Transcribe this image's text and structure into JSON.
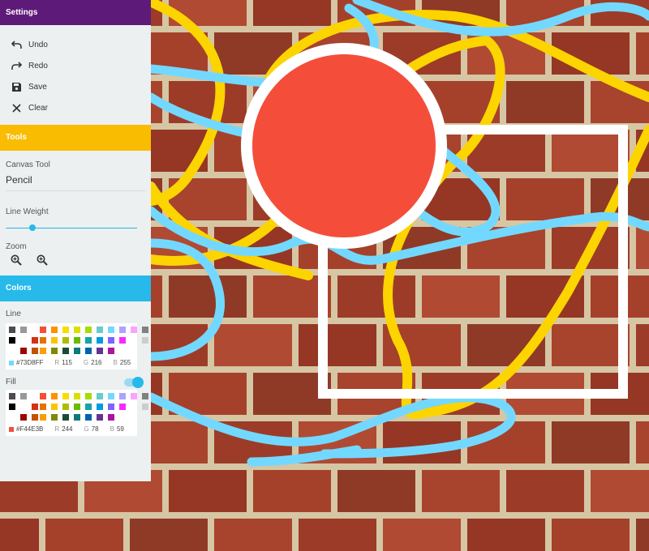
{
  "settings": {
    "title": "Settings",
    "items": [
      {
        "label": "Undo",
        "icon": "undo-icon"
      },
      {
        "label": "Redo",
        "icon": "redo-icon"
      },
      {
        "label": "Save",
        "icon": "save-icon"
      },
      {
        "label": "Clear",
        "icon": "clear-icon"
      }
    ]
  },
  "tools": {
    "title": "Tools",
    "canvas_tool_label": "Canvas Tool",
    "canvas_tool_value": "Pencil",
    "line_weight_label": "Line Weight",
    "line_weight_level": 0.2,
    "zoom_label": "Zoom"
  },
  "colors": {
    "title": "Colors",
    "line": {
      "label": "Line",
      "hex": "#73D8FF",
      "r_label": "R",
      "r": "115",
      "g_label": "G",
      "g": "216",
      "b_label": "B",
      "b": "255"
    },
    "fill": {
      "label": "Fill",
      "enabled": true,
      "hex": "#F44E3B",
      "r_label": "R",
      "r": "244",
      "g_label": "G",
      "g": "78",
      "b_label": "B",
      "b": "59"
    },
    "grays": [
      "#4d4d4d",
      "#999999",
      "#333333",
      "#808080",
      "#000000",
      "#666666",
      "#ffffff",
      "#cccccc",
      "#b3b3b3"
    ],
    "hues": [
      [
        "#f44e3b",
        "#fe9200",
        "#fcdc00",
        "#dbdf00",
        "#a4dd00",
        "#68ccca",
        "#73d8ff",
        "#aea1ff",
        "#fda1ff"
      ],
      [
        "#d33115",
        "#e27300",
        "#fcc400",
        "#b0bc00",
        "#68bc00",
        "#16a5a5",
        "#009ce0",
        "#7b64ff",
        "#fa28ff"
      ],
      [
        "#9f0500",
        "#c45100",
        "#fb9e00",
        "#808900",
        "#194d33",
        "#0c797d",
        "#0062b1",
        "#653294",
        "#ab149e"
      ]
    ]
  },
  "canvas": {
    "brick_color": "#a8432d",
    "mortar_color": "#d6c6a4",
    "line_blue": "#73d8ff",
    "line_yellow": "#fcd400",
    "circle_fill": "#f44e3b",
    "stroke_white": "#ffffff"
  }
}
